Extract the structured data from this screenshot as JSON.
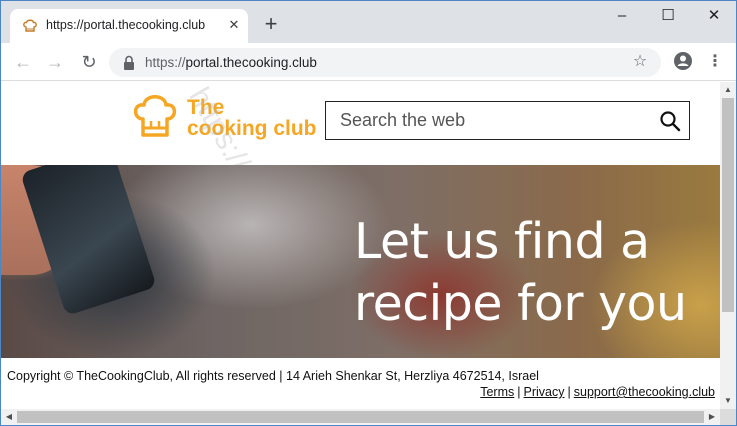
{
  "browser": {
    "tab": {
      "title": "https://portal.thecooking.club",
      "favicon": "chef-hat-icon"
    },
    "new_tab_label": "+",
    "window_controls": {
      "minimize": "–",
      "maximize": "☐",
      "close": "✕"
    },
    "toolbar": {
      "back_icon": "←",
      "forward_icon": "→",
      "reload_icon": "↻",
      "url_scheme": "https://",
      "url_host": "portal.thecooking.club",
      "star_icon": "☆",
      "menu_icon": "⋮"
    }
  },
  "page": {
    "logo": {
      "line1": "The",
      "line2": "cooking club",
      "color": "#f5a623"
    },
    "watermark": "https://p",
    "search": {
      "placeholder": "Search the web",
      "value": ""
    },
    "hero": {
      "line1": "Let us find a",
      "line2": "recipe for you"
    },
    "footer": {
      "copyright": "Copyright © TheCookingClub, All rights reserved | 14 Arieh Shenkar St, Herzliya 4672514, Israel",
      "links": {
        "terms": "Terms",
        "privacy": "Privacy",
        "support": "support@thecooking.club"
      },
      "separator": "|"
    }
  },
  "scrollbars": {
    "up": "▲",
    "down": "▼",
    "left": "◀",
    "right": "▶"
  }
}
